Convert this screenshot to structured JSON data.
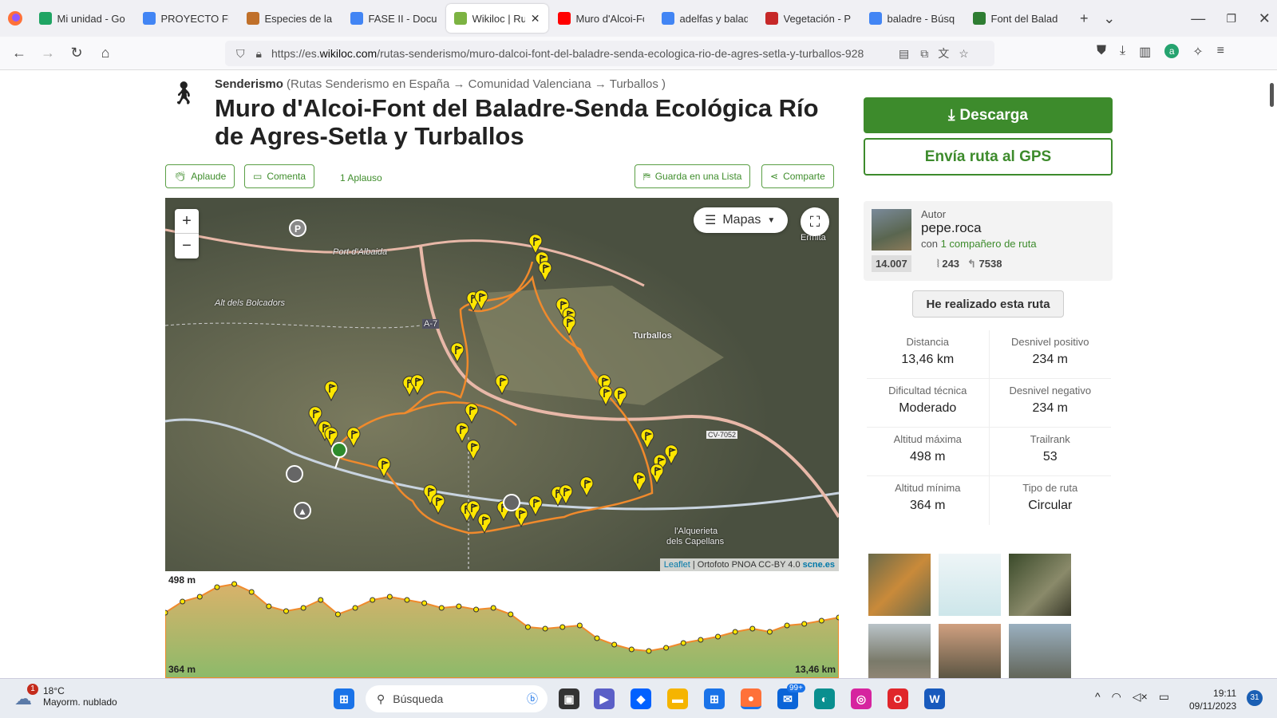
{
  "tabs": [
    {
      "label": "Mi unidad - Go",
      "color": "#1fa463"
    },
    {
      "label": "PROYECTO FINA",
      "color": "#4285f4"
    },
    {
      "label": "Especies de la",
      "color": "#c0702a"
    },
    {
      "label": "FASE II - Docum",
      "color": "#4285f4"
    },
    {
      "label": "Wikiloc | Ru",
      "color": "#7cb342",
      "active": true
    },
    {
      "label": "Muro d'Alcoi-Fo",
      "color": "#ff0000"
    },
    {
      "label": "adelfas y balad",
      "color": "#4285f4"
    },
    {
      "label": "Vegetación - P",
      "color": "#c62828"
    },
    {
      "label": "baladre - Búsq",
      "color": "#4285f4"
    },
    {
      "label": "Font del Balad",
      "color": "#2e7d32"
    }
  ],
  "browser": {
    "url_prefix": "https://es.",
    "url_domain": "wikiloc.com",
    "url_rest": "/rutas-senderismo/muro-dalcoi-font-del-baladre-senda-ecologica-rio-de-agres-setla-y-turballos-928"
  },
  "breadcrumb": {
    "activity": "Senderismo",
    "path": "(Rutas Senderismo en España → Comunidad Valenciana → Turballos )"
  },
  "title": "Muro d'Alcoi-Font del Baladre-Senda Ecológica Río de Agres-Setla y Turballos",
  "actions": {
    "applaud": "Aplaude",
    "comment": "Comenta",
    "applause_count": "1 Aplauso",
    "save_list": "Guarda en una Lista",
    "share": "Comparte"
  },
  "map": {
    "layers_label": "Mapas",
    "zoom_in": "+",
    "zoom_out": "−",
    "attribution_link": "Leaflet",
    "attribution_text": " | Ortofoto PNOA CC-BY 4.0 ",
    "attribution_src": "scne.es",
    "labels": {
      "port": "Port d'Albaida",
      "alt": "Alt dels Bolcadors",
      "turballos": "Turballos",
      "alqueria": "l'Alquerieta",
      "capellans": "dels Capellans",
      "a7": "A-7",
      "cv": "CV-7052",
      "ermita": "Ermita"
    }
  },
  "profile": {
    "max": "498 m",
    "min": "364 m",
    "distance": "13,46 km"
  },
  "sidebar": {
    "download": "Descarga",
    "send_gps": "Envía ruta al GPS",
    "author_role": "Autor",
    "author_name": "pepe.roca",
    "companion_prefix": "con ",
    "companion_link": "1 compañero de ruta",
    "rank": "14.007",
    "trails": "243",
    "followers": "7538",
    "done": "He realizado esta ruta"
  },
  "stats": [
    [
      {
        "label": "Distancia",
        "value": "13,46 km"
      },
      {
        "label": "Desnivel positivo",
        "value": "234 m"
      }
    ],
    [
      {
        "label": "Dificultad técnica",
        "value": "Moderado"
      },
      {
        "label": "Desnivel negativo",
        "value": "234 m"
      }
    ],
    [
      {
        "label": "Altitud máxima",
        "value": "498 m"
      },
      {
        "label": "Trailrank",
        "value": "53"
      }
    ],
    [
      {
        "label": "Altitud mínima",
        "value": "364 m"
      },
      {
        "label": "Tipo de ruta",
        "value": "Circular"
      }
    ]
  ],
  "taskbar": {
    "temp": "18°C",
    "weather": "Mayorm. nublado",
    "weather_badge": "1",
    "search": "Búsqueda",
    "mail_badge": "99+",
    "time": "19:11",
    "date": "09/11/2023",
    "notif": "31"
  },
  "colors": {
    "brand_green": "#3d8b2c",
    "track": "#f08a2c",
    "waypoint": "#ffe600"
  }
}
